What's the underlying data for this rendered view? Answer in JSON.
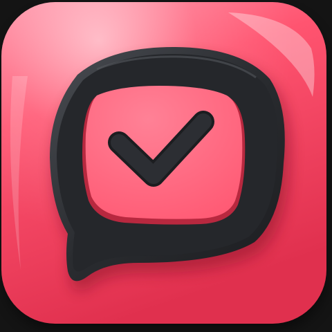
{
  "icon": {
    "name": "chat-check-app-icon",
    "depicts": "speech-bubble-with-checkmark",
    "colors": {
      "background": "#141414",
      "tile_light": "#ff8aa0",
      "tile_mid": "#ff5470",
      "tile_dark": "#e0304e",
      "bubble": "#25272b",
      "bubble_highlight": "#3a3d42",
      "inner_light": "#ff8196",
      "inner_mid": "#ff5a74",
      "check": "#25272b"
    }
  }
}
